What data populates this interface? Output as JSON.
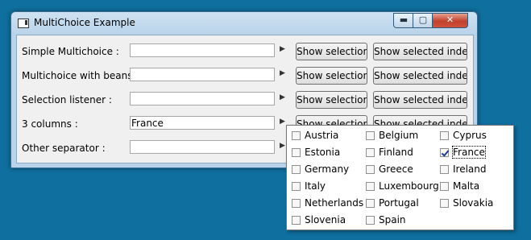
{
  "window": {
    "title": "MultiChoice Example",
    "min_glyph": "▬",
    "max_glyph": "▢",
    "close_glyph": "✕"
  },
  "rows": [
    {
      "label": "Simple Multichoice :",
      "value": "",
      "show_selection": "Show selection",
      "show_index": "Show selected index"
    },
    {
      "label": "Multichoice with beans :",
      "value": "",
      "show_selection": "Show selection",
      "show_index": "Show selected index"
    },
    {
      "label": "Selection listener :",
      "value": "",
      "show_selection": "Show selection",
      "show_index": "Show selected index"
    },
    {
      "label": "3 columns :",
      "value": "France",
      "show_selection": "Show selection",
      "show_index": "Show selected index"
    },
    {
      "label": "Other separator :",
      "value": "",
      "show_selection": "",
      "show_index": ""
    }
  ],
  "arrow_glyph": "▶",
  "popup": {
    "options": [
      {
        "label": "Austria",
        "checked": false
      },
      {
        "label": "Belgium",
        "checked": false
      },
      {
        "label": "Cyprus",
        "checked": false
      },
      {
        "label": "Estonia",
        "checked": false
      },
      {
        "label": "Finland",
        "checked": false
      },
      {
        "label": "France",
        "checked": true
      },
      {
        "label": "Germany",
        "checked": false
      },
      {
        "label": "Greece",
        "checked": false
      },
      {
        "label": "Ireland",
        "checked": false
      },
      {
        "label": "Italy",
        "checked": false
      },
      {
        "label": "Luxembourg",
        "checked": false
      },
      {
        "label": "Malta",
        "checked": false
      },
      {
        "label": "Netherlands",
        "checked": false
      },
      {
        "label": "Portugal",
        "checked": false
      },
      {
        "label": "Slovakia",
        "checked": false
      },
      {
        "label": "Slovenia",
        "checked": false
      },
      {
        "label": "Spain",
        "checked": false
      }
    ]
  }
}
